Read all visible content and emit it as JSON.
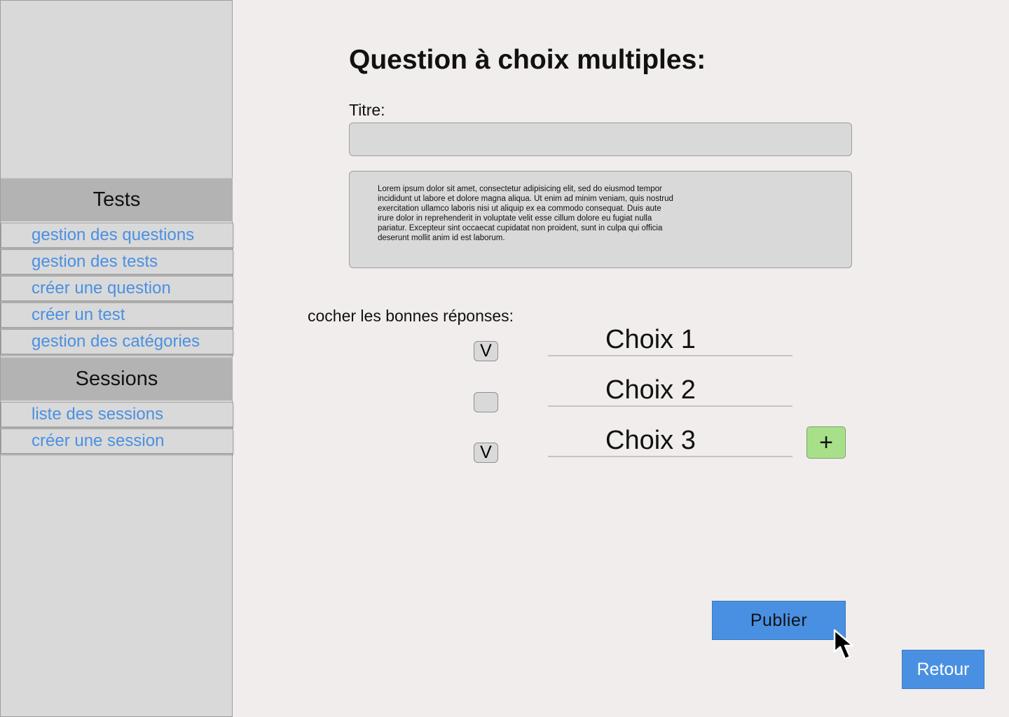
{
  "sidebar": {
    "sections": [
      {
        "title": "Tests",
        "items": [
          {
            "label": "gestion des questions"
          },
          {
            "label": "gestion des tests"
          },
          {
            "label": "créer une question"
          },
          {
            "label": "créer un test"
          },
          {
            "label": "gestion des catégories"
          }
        ]
      },
      {
        "title": "Sessions",
        "items": [
          {
            "label": "liste des sessions"
          },
          {
            "label": "créer une session"
          }
        ]
      }
    ]
  },
  "form": {
    "page_title": "Question à choix multiples:",
    "title_label": "Titre:",
    "title_value": "",
    "description": "Lorem ipsum dolor sit amet, consectetur adipisicing elit, sed do eiusmod tempor incididunt ut labore et dolore magna aliqua. Ut enim ad minim veniam, quis nostrud exercitation ullamco laboris nisi ut aliquip ex ea commodo consequat. Duis aute irure dolor in reprehenderit in voluptate velit esse cillum dolore eu fugiat nulla pariatur. Excepteur sint occaecat cupidatat non proident, sunt in culpa qui officia deserunt mollit anim id est laborum.",
    "check_instruction": "cocher les bonnes réponses:",
    "choices": [
      {
        "label": "Choix 1",
        "checked": true,
        "mark": "V"
      },
      {
        "label": "Choix 2",
        "checked": false,
        "mark": ""
      },
      {
        "label": "Choix 3",
        "checked": true,
        "mark": "V"
      }
    ],
    "add_label": "+",
    "publish_label": "Publier",
    "back_label": "Retour"
  },
  "colors": {
    "accent": "#4a90e2",
    "add_button": "#a8e08a",
    "sidebar_bg": "#d9d9d9",
    "section_header_bg": "#b3b3b3",
    "page_bg": "#f0edec"
  },
  "icons": {
    "cursor": "arrow-cursor-icon",
    "add": "plus-icon"
  }
}
